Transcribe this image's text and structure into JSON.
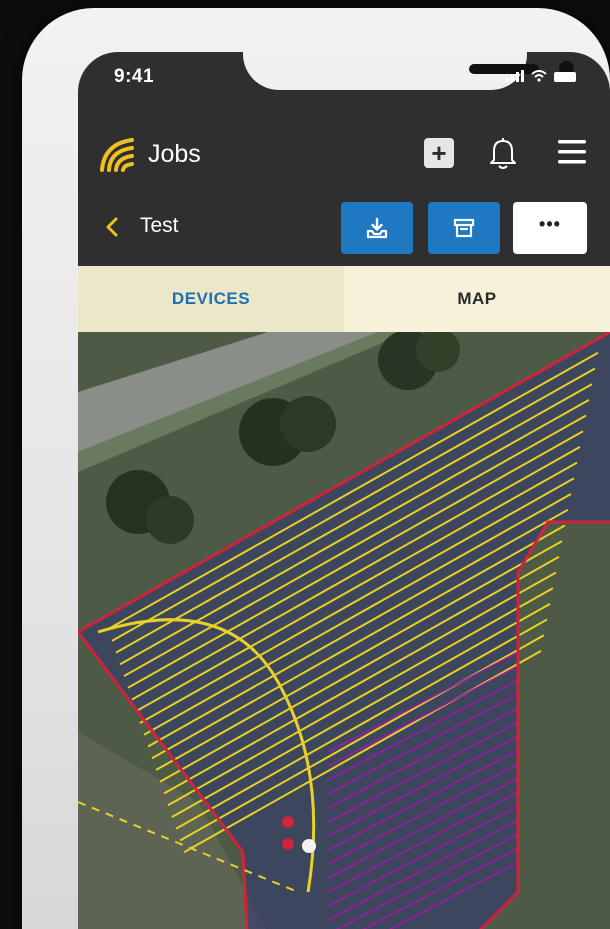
{
  "status_bar": {
    "time": "9:41"
  },
  "header": {
    "app_title": "Jobs",
    "add_label": "+"
  },
  "job": {
    "name": "Test",
    "more_label": "•••"
  },
  "tabs": [
    {
      "label": "DEVICES",
      "active": true
    },
    {
      "label": "MAP",
      "active": false
    }
  ],
  "icons": {
    "logo": "signal-waves-icon",
    "add": "plus-icon",
    "notifications": "bell-icon",
    "menu": "hamburger-menu-icon",
    "back": "chevron-left-icon",
    "download": "download-tray-icon",
    "archive": "archive-box-icon",
    "more": "ellipsis-icon"
  },
  "colors": {
    "accent_yellow": "#f0c020",
    "primary_blue": "#1e78c2",
    "header_bg": "#2f2f2f",
    "tab_active_text": "#1f6fb3",
    "boundary_red": "#d0243a",
    "path_yellow": "#e8d027",
    "path_purple": "#a01aa6"
  }
}
